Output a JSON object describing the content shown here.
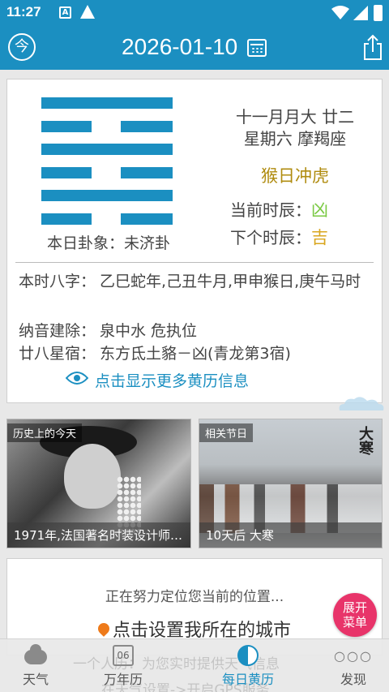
{
  "status_bar": {
    "time": "11:27",
    "notif_a": "A"
  },
  "header": {
    "today_icon": "今",
    "date": "2026-01-10"
  },
  "hexagram": {
    "lines": [
      "yang",
      "yin",
      "yang",
      "yin",
      "yang",
      "yin"
    ],
    "caption": "本日卦象：未济卦"
  },
  "lunar": {
    "line1": "十一月月大 廿二",
    "line2": "星期六 摩羯座",
    "clash": "猴日冲虎",
    "current_hour_label": "当前时辰：",
    "current_hour_value": "凶",
    "current_hour_color": "#7ac943",
    "next_hour_label": "下个时辰：",
    "next_hour_value": "吉",
    "next_hour_color": "#d9a61e"
  },
  "info": {
    "bazi_label": "本时八字：",
    "bazi_value": "乙巳蛇年,己丑牛月,甲申猴日,庚午马时",
    "nayin_label": "纳音建除：",
    "nayin_value": "泉中水 危执位",
    "star_label": "廿八星宿：",
    "star_value": "东方氐土貉－凶(青龙第3宿)",
    "more_link": "点击显示更多黄历信息"
  },
  "cards": {
    "history_tag": "历史上的今天",
    "history_caption": "1971年,法国著名时装设计师…",
    "festival_tag": "相关节日",
    "festival_caption": "10天后 大寒",
    "festival_image_title": "大寒"
  },
  "location": {
    "status": "正在努力定位您当前的位置...",
    "set_city": "点击设置我所在的城市",
    "ghost_line1": "一个人历：为您实时提供天气信息",
    "ghost_line2": "在天气设置->开启GPS服务"
  },
  "expand_button": {
    "line1": "展开",
    "line2": "菜单"
  },
  "bottom_nav": {
    "weather": "天气",
    "calendar": "万年历",
    "calendar_day": "06",
    "daily": "每日黄历",
    "discover": "发现"
  },
  "colors": {
    "primary": "#1b8fc1",
    "accent_pink": "#e8346a",
    "clash_gold": "#b08c10"
  }
}
